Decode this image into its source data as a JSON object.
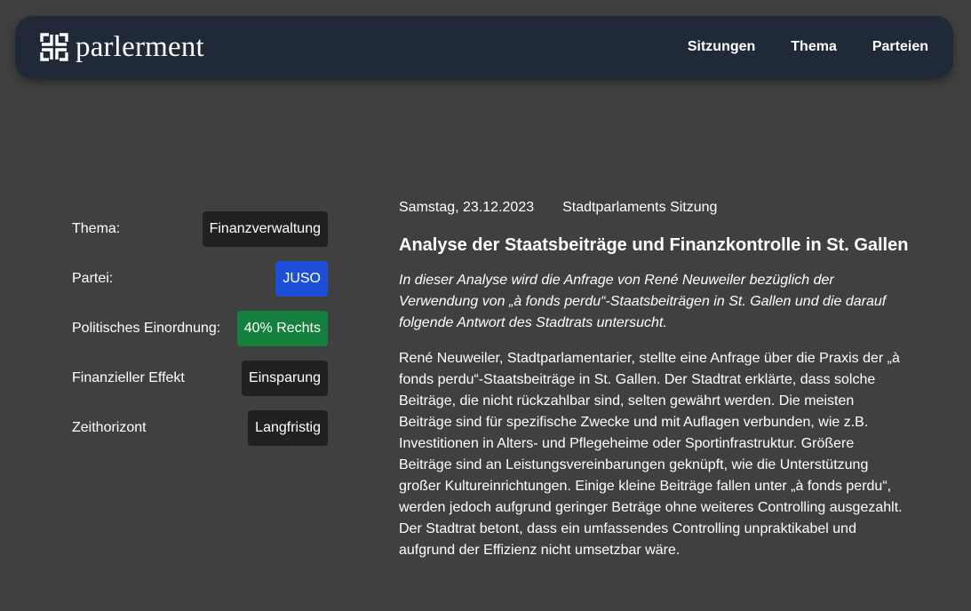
{
  "brand": {
    "name": "parlerment",
    "logo_icon": "bracket-cross-icon"
  },
  "nav": {
    "items": [
      {
        "label": "Sitzungen"
      },
      {
        "label": "Thema"
      },
      {
        "label": "Parteien"
      }
    ]
  },
  "meta": {
    "rows": [
      {
        "label": "Thema:",
        "value": "Finanzverwaltung"
      },
      {
        "label": "Partei:",
        "value": "JUSO"
      },
      {
        "label": "Politisches Einordnung:",
        "value": "40% Rechts"
      },
      {
        "label": "Finanzieller Effekt",
        "value": "Einsparung"
      },
      {
        "label": "Zeithorizont",
        "value": "Langfristig"
      }
    ]
  },
  "article": {
    "date": "Samstag, 23.12.2023",
    "session_type": "Stadtparlaments Sitzung",
    "title": "Analyse der Staatsbeiträge und Finanzkontrolle in St. Gallen",
    "lead": "In dieser Analyse wird die Anfrage von René Neuweiler bezüglich der Verwendung von „à fonds perdu“-Staatsbeiträgen in St. Gallen und die darauf folgende Antwort des Stadtrats untersucht.",
    "body": "René Neuweiler, Stadtparlamentarier, stellte eine Anfrage über die Praxis der „à fonds perdu“-Staatsbeiträge in St. Gallen. Der Stadtrat erklärte, dass solche Beiträge, die nicht rückzahlbar sind, selten gewährt werden. Die meisten Beiträge sind für spezifische Zwecke und mit Auflagen verbunden, wie z.B. Investitionen in Alters- und Pflegeheime oder Sportinfrastruktur. Größere Beiträge sind an Leistungsvereinbarungen geknüpft, wie die Unterstützung großer Kultureinrichtungen. Einige kleine Beiträge fallen unter „à fonds perdu“, werden jedoch aufgrund geringer Beträge ohne weiteres Controlling ausgezahlt. Der Stadtrat betont, dass ein umfassendes Controlling unpraktikabel und aufgrund der Effizienz nicht umsetzbar wäre."
  },
  "colors": {
    "page_background": "#404040",
    "navbar_background": "#1f2937",
    "badge_default": "#212121",
    "badge_party": "#1d4ed8",
    "badge_political": "#15803d"
  }
}
